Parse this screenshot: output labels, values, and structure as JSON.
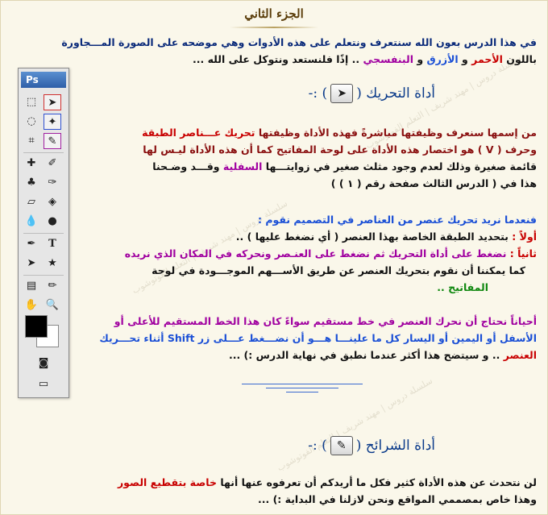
{
  "title": "الجزء الثاني",
  "intro": {
    "line1": "في هذا الدرس بعون الله سنتعرف ونتعلم على هذه الأدوات وهي موضحه على الصورة المـــجاورة",
    "line2_a": "باللون",
    "red_word": "الأحمر",
    "and1": "و",
    "blue_word": "الأزرق",
    "and2": "و",
    "purple_word": "البنفسجي",
    "line2_b": ".. إذًا فلنستعد ونتوكل على الله ..."
  },
  "move_tool": {
    "heading": "أداة التحريك (",
    "heading_end": ") :-",
    "p1_l1_a": "من إسمها سنعرف وظيفتها مباشرةً فهذه الأداة وظيفتها",
    "p1_l1_red": "تحريك عـــناصر الطبقة",
    "p1_l2": "وحرف ( V ) هو اختصار هذه الأداة على لوحة المفاتيح كما أن هذه الأداة ليـس لها",
    "p1_l3_a": "قائمة صغيرة وذلك لعدم وجود مثلث صغير في زوايتـــها",
    "p1_l3_purple": "السفلية",
    "p1_l3_b": "وقـــد وضـحنا",
    "p1_l4": "هذا في ( الدرس الثالث صفحة رقم ( ١ ) )",
    "q": "فنعدما نريد تحريك عنصر من العناصر في التصميم نقوم :",
    "first_label": "أولاً :",
    "first_text": "بتحديد الطبقة الخاصة بهذا العنصر ( أي نضغط عليها ) ..",
    "second_label": "ثانياً :",
    "second_text": "نضغط على أداة التحريك ثم نضغط على العنـصر ونحركه في المكان الذي نريده",
    "second_l2": "كما يمكننا أن نقوم بتحريك العنصر عن طريق الأســـهم الموجـــودة في لوحة",
    "second_l3": "المفاتيح ..",
    "p3_l1": "أحياناً نحتاج أن نحرك العنصر في خط مستقيم سواءً كان هذا الخط المستقيم للأعلى أو",
    "p3_l2": "الأسفل أو اليمين أو اليسار كل ما علينـــا هـــو أن نضـــغط عـــلى زر Shift أثناء تحـــريك",
    "p3_l3_red": "العنصر",
    "p3_l3_b": ".. و سيتضح هذا أكثر عندما نطبق في نهاية الدرس :) ..."
  },
  "slice_tool": {
    "heading": "أداة الشرائح (",
    "heading_end": ") :-",
    "l1_a": "لن نتحدث عن هذه الأداة كثير فكل ما أريدكم أن تعرفوه عنها أنها",
    "l1_red": "خاصة بتقطيع الصور",
    "l2": "وهذا خاص بمصممي المواقع ونحن لازلنا في البداية :) ..."
  },
  "toolbox": {
    "logo": "Ps",
    "text_tool": "T"
  },
  "watermark": "سلسلة دروس | مهند شريف | التعلم الفوتوشوب",
  "colors": {
    "red": "#c80000",
    "blue": "#1a4fd6",
    "purple": "#a000a0",
    "green": "#108810",
    "heading": "#0a3a8a"
  }
}
